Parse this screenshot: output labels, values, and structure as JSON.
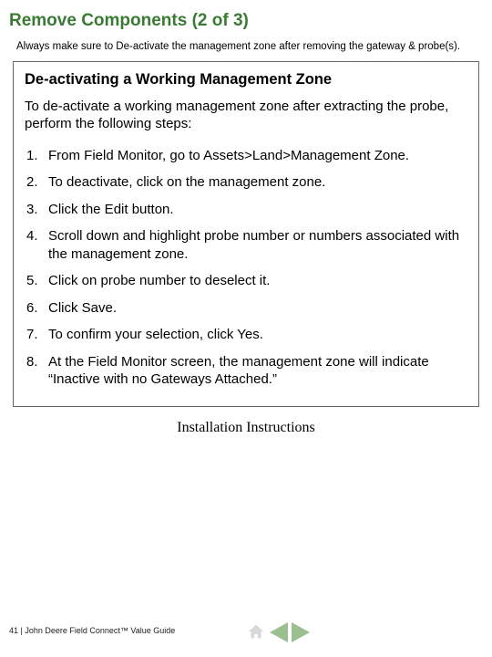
{
  "title": "Remove Components (2 of 3)",
  "intro": "Always make sure to De-activate the management zone after removing the gateway & probe(s).",
  "box": {
    "heading": "De-activating a Working Management Zone",
    "lead": "To de-activate a working management zone after extracting the probe, perform the following steps:",
    "steps": [
      "From Field Monitor, go to Assets>Land>Management Zone.",
      "To deactivate, click on the management zone.",
      "Click the Edit button.",
      "Scroll down and highlight probe number or numbers associated with the management zone.",
      "Click on probe number to deselect it.",
      "Click Save.",
      "To confirm your selection, click Yes.",
      "At the Field Monitor screen, the management zone will indicate “Inactive with no Gateways Attached.”"
    ]
  },
  "section_label": "Installation Instructions",
  "footer": "41 | John Deere Field Connect™ Value Guide"
}
